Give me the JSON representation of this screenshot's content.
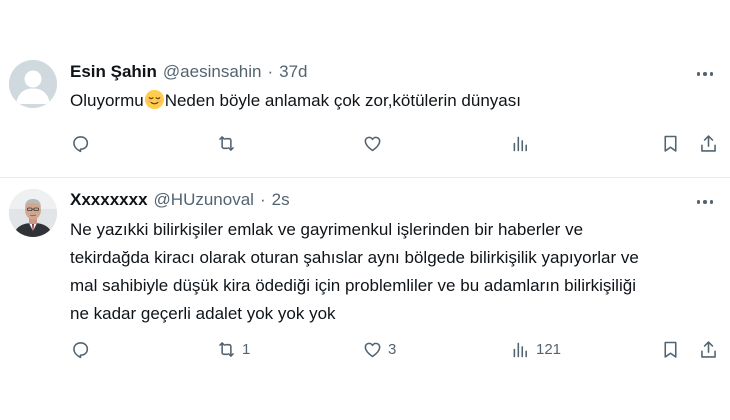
{
  "tweets": [
    {
      "name": "Esin Şahin",
      "handle": "@aesinsahin",
      "separator": "·",
      "time": "37d",
      "text_before_emoji": "Oluyormu",
      "emoji_icon": "relieved-face-emoji",
      "text_after_emoji": "Neden böyle anlamak çok zor,kötülerin dünyası",
      "retweets": "",
      "likes": "",
      "views": ""
    },
    {
      "name": "Xxxxxxxx",
      "handle": "@HUzunoval",
      "separator": "·",
      "time": "2s",
      "text": "Ne yazıkki bilirkişiler emlak ve gayrimenkul işlerinden bir haberler ve\ntekirdağda kiracı olarak oturan şahıslar aynı bölgede bilirkişilik yapıyorlar ve\nmal sahibiyle düşük kira ödediği için problemliler ve bu adamların bilirkişiliği\nne kadar geçerli adalet yok yok yok",
      "retweets": "1",
      "likes": "3",
      "views": "121"
    }
  ],
  "colors": {
    "text": "#0f1419",
    "secondary": "#536471",
    "divider": "#e6ecf0",
    "avatar_placeholder": "#cfd9de"
  }
}
